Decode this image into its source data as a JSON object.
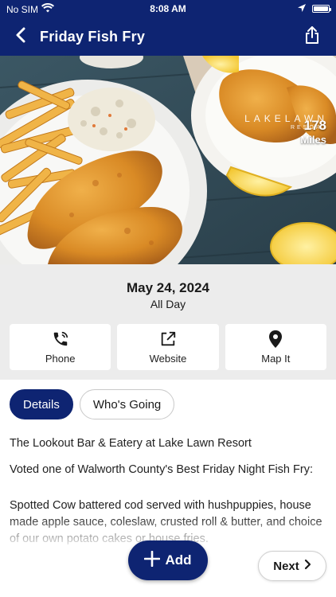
{
  "status_bar": {
    "carrier": "No SIM",
    "time": "8:08 AM"
  },
  "nav": {
    "title": "Friday Fish Fry",
    "back_icon": "chevron-left-icon",
    "share_icon": "share-icon"
  },
  "hero": {
    "brand_line1": "LAKELAWN",
    "brand_line2": "RESORT",
    "distance_value": "178",
    "distance_unit": "Miles"
  },
  "event": {
    "date": "May 24, 2024",
    "time": "All Day"
  },
  "actions": [
    {
      "label": "Phone",
      "icon": "phone-icon"
    },
    {
      "label": "Website",
      "icon": "external-link-icon"
    },
    {
      "label": "Map It",
      "icon": "map-pin-icon"
    }
  ],
  "tabs": [
    {
      "label": "Details",
      "active": true
    },
    {
      "label": "Who's Going",
      "active": false
    }
  ],
  "details": {
    "venue": "The Lookout Bar & Eatery at Lake Lawn Resort",
    "tagline": "Voted one of Walworth County's Best Friday Night Fish Fry:",
    "description": "Spotted Cow battered cod served with hushpuppies, house made apple sauce, coleslaw, crusted roll & butter, and choice of our own potato cakes or house fries."
  },
  "buttons": {
    "add_label": "Add",
    "next_label": "Next"
  },
  "colors": {
    "brand_navy": "#0e2472",
    "panel_gray": "#ececec"
  }
}
